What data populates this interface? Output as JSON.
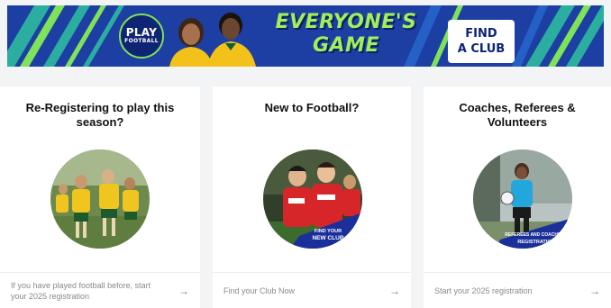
{
  "banner": {
    "logo_line1": "PLAY",
    "logo_line2": "FOOTBALL",
    "headline_line1": "EVERYONE'S",
    "headline_line2": "GAME",
    "cta_line1": "FIND",
    "cta_line2": "A CLUB",
    "colors": {
      "background": "#1d3fa3",
      "accent": "#9ff05a",
      "navy": "#0e2474"
    }
  },
  "cards": [
    {
      "title": "Re-Registering to play this season?",
      "footer": "If you have played football before, start your 2025 registration",
      "arrow_icon": "arrow-right-icon"
    },
    {
      "title": "New to Football?",
      "badge_line1": "FIND YOUR",
      "badge_line2": "NEW CLUB",
      "footer": "Find your Club Now",
      "arrow_icon": "arrow-right-icon"
    },
    {
      "title": "Coaches, Referees & Volunteers",
      "badge_line1": "REFEREES AND COACHES",
      "badge_line2": "REGISTRATION",
      "footer": "Start your 2025 registration",
      "arrow_icon": "arrow-right-icon"
    }
  ],
  "arrow_glyph": "→"
}
